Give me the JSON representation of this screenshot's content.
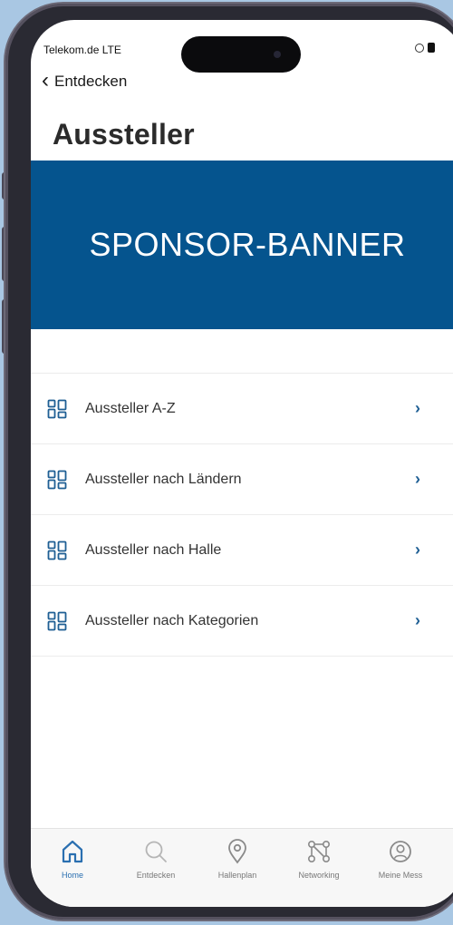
{
  "status_bar": {
    "carrier": "Telekom.de  LTE"
  },
  "nav": {
    "back_label": "Entdecken"
  },
  "page": {
    "title": "Aussteller"
  },
  "banner": {
    "text": "SPONSOR-BANNER",
    "color": "#05548e"
  },
  "menu": {
    "items": [
      {
        "label": "Aussteller A-Z",
        "icon": "grid-icon"
      },
      {
        "label": "Aussteller nach Ländern",
        "icon": "grid-icon"
      },
      {
        "label": "Aussteller nach Halle",
        "icon": "grid-icon"
      },
      {
        "label": "Aussteller nach Kategorien",
        "icon": "grid-icon"
      }
    ],
    "accent_color": "#1f5f94"
  },
  "tabbar": {
    "tabs": [
      {
        "label": "Home",
        "icon": "home-icon",
        "active": true
      },
      {
        "label": "Entdecken",
        "icon": "search-icon",
        "active": false
      },
      {
        "label": "Hallenplan",
        "icon": "map-pin-icon",
        "active": false
      },
      {
        "label": "Networking",
        "icon": "network-icon",
        "active": false
      },
      {
        "label": "Meine Mess",
        "icon": "profile-icon",
        "active": false
      }
    ],
    "active_color": "#2a6fb0"
  }
}
